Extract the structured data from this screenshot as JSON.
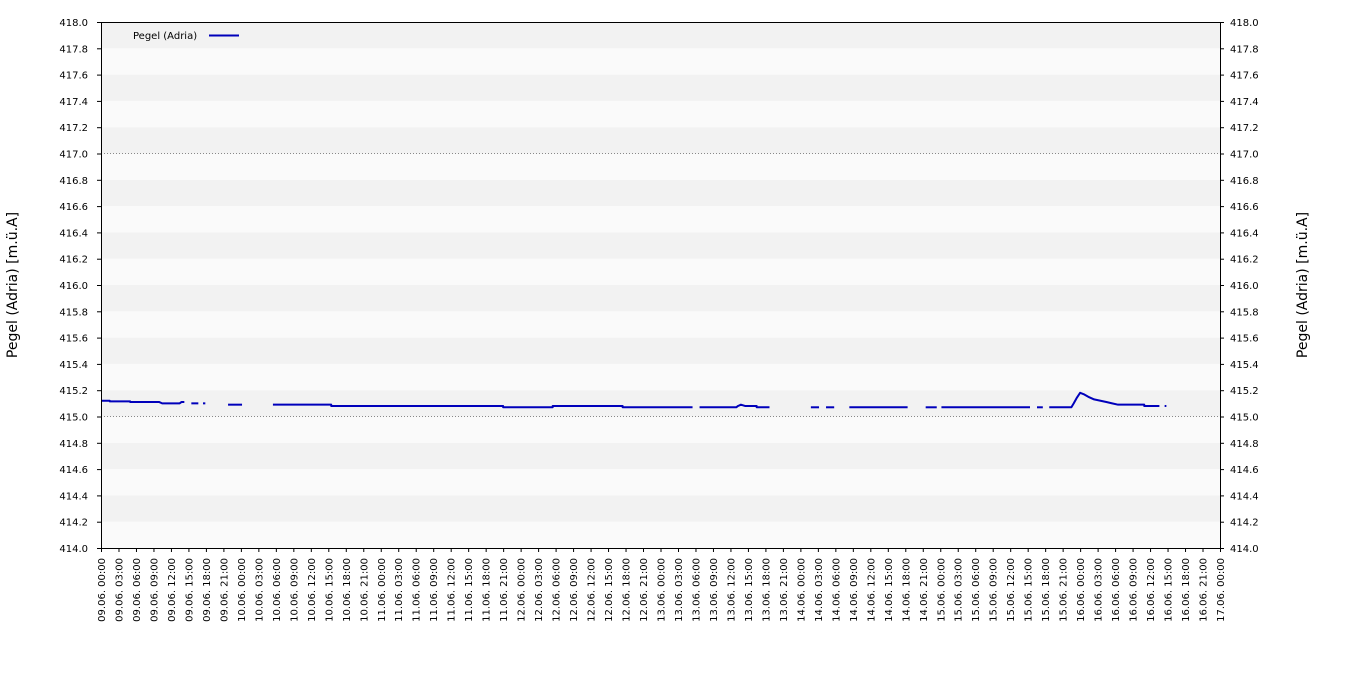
{
  "chart_data": {
    "type": "line",
    "title": "",
    "ylabel": "Pegel (Adria) [m.ü.A]",
    "ylim": [
      414.0,
      418.0
    ],
    "y_ticks": [
      "414.0",
      "414.2",
      "414.4",
      "414.6",
      "414.8",
      "415.0",
      "415.2",
      "415.4",
      "415.6",
      "415.8",
      "416.0",
      "416.2",
      "416.4",
      "416.6",
      "416.8",
      "417.0",
      "417.2",
      "417.4",
      "417.6",
      "417.8",
      "418.0"
    ],
    "reference_lines": [
      415.0,
      417.0
    ],
    "x_tick_labels": [
      "09.06. 00:00",
      "09.06. 03:00",
      "09.06. 06:00",
      "09.06. 09:00",
      "09.06. 12:00",
      "09.06. 15:00",
      "09.06. 18:00",
      "09.06. 21:00",
      "10.06. 00:00",
      "10.06. 03:00",
      "10.06. 06:00",
      "10.06. 09:00",
      "10.06. 12:00",
      "10.06. 15:00",
      "10.06. 18:00",
      "10.06. 21:00",
      "11.06. 00:00",
      "11.06. 03:00",
      "11.06. 06:00",
      "11.06. 09:00",
      "11.06. 12:00",
      "11.06. 15:00",
      "11.06. 18:00",
      "11.06. 21:00",
      "12.06. 00:00",
      "12.06. 03:00",
      "12.06. 06:00",
      "12.06. 09:00",
      "12.06. 12:00",
      "12.06. 15:00",
      "12.06. 18:00",
      "12.06. 21:00",
      "13.06. 00:00",
      "13.06. 03:00",
      "13.06. 06:00",
      "13.06. 09:00",
      "13.06. 12:00",
      "13.06. 15:00",
      "13.06. 18:00",
      "13.06. 21:00",
      "14.06. 00:00",
      "14.06. 03:00",
      "14.06. 06:00",
      "14.06. 09:00",
      "14.06. 12:00",
      "14.06. 15:00",
      "14.06. 18:00",
      "14.06. 21:00",
      "15.06. 00:00",
      "15.06. 03:00",
      "15.06. 06:00",
      "15.06. 09:00",
      "15.06. 12:00",
      "15.06. 15:00",
      "15.06. 18:00",
      "15.06. 21:00",
      "16.06. 00:00",
      "16.06. 03:00",
      "16.06. 06:00",
      "16.06. 09:00",
      "16.06. 12:00",
      "16.06. 15:00",
      "16.06. 18:00",
      "16.06. 21:00",
      "17.06. 00:00"
    ],
    "x_unit": "hours since 09.06. 00:00",
    "xlim": [
      0,
      192
    ],
    "legend_position": "top-left",
    "series": [
      {
        "name": "Pegel (Adria)",
        "color": "#0000bb",
        "segments": [
          [
            [
              0,
              415.12
            ],
            [
              1.5,
              415.12
            ],
            [
              1.5,
              415.115
            ],
            [
              5,
              415.115
            ],
            [
              5,
              415.11
            ],
            [
              10,
              415.11
            ],
            [
              10.5,
              415.1
            ],
            [
              13.5,
              415.1
            ],
            [
              13.8,
              415.11
            ],
            [
              14.3,
              415.11
            ]
          ],
          [
            [
              15.5,
              415.1
            ],
            [
              16.7,
              415.1
            ]
          ],
          [
            [
              17.5,
              415.1
            ],
            [
              17.9,
              415.1
            ]
          ],
          [
            [
              21.8,
              415.09
            ],
            [
              24.2,
              415.09
            ]
          ],
          [
            [
              29.5,
              415.09
            ],
            [
              39.5,
              415.09
            ],
            [
              39.5,
              415.08
            ],
            [
              69,
              415.08
            ],
            [
              69,
              415.07
            ],
            [
              77.5,
              415.07
            ],
            [
              77.5,
              415.08
            ],
            [
              89.5,
              415.08
            ],
            [
              89.5,
              415.07
            ],
            [
              101.5,
              415.07
            ]
          ],
          [
            [
              102.7,
              415.07
            ],
            [
              109,
              415.07
            ],
            [
              109.3,
              415.08
            ],
            [
              109.8,
              415.09
            ],
            [
              110.5,
              415.08
            ],
            [
              112.5,
              415.08
            ],
            [
              112.5,
              415.07
            ],
            [
              114.7,
              415.07
            ]
          ],
          [
            [
              121.8,
              415.07
            ],
            [
              123.2,
              415.07
            ]
          ],
          [
            [
              124.4,
              415.07
            ],
            [
              125.8,
              415.07
            ]
          ],
          [
            [
              128.4,
              415.07
            ],
            [
              138.4,
              415.07
            ]
          ],
          [
            [
              141.5,
              415.07
            ],
            [
              143.4,
              415.07
            ]
          ],
          [
            [
              144.2,
              415.07
            ],
            [
              159.4,
              415.07
            ]
          ],
          [
            [
              160.6,
              415.07
            ],
            [
              161.6,
              415.07
            ]
          ],
          [
            [
              162.7,
              415.07
            ],
            [
              166.5,
              415.07
            ],
            [
              166.9,
              415.1
            ],
            [
              167.4,
              415.14
            ],
            [
              168,
              415.18
            ],
            [
              168.6,
              415.17
            ],
            [
              169.4,
              415.15
            ],
            [
              170.4,
              415.13
            ],
            [
              171.5,
              415.12
            ],
            [
              172.5,
              415.11
            ],
            [
              173.5,
              415.1
            ],
            [
              174.5,
              415.09
            ],
            [
              179,
              415.09
            ],
            [
              179,
              415.08
            ],
            [
              181.6,
              415.08
            ]
          ],
          [
            [
              182.5,
              415.08
            ],
            [
              182.8,
              415.08
            ]
          ]
        ]
      }
    ]
  }
}
